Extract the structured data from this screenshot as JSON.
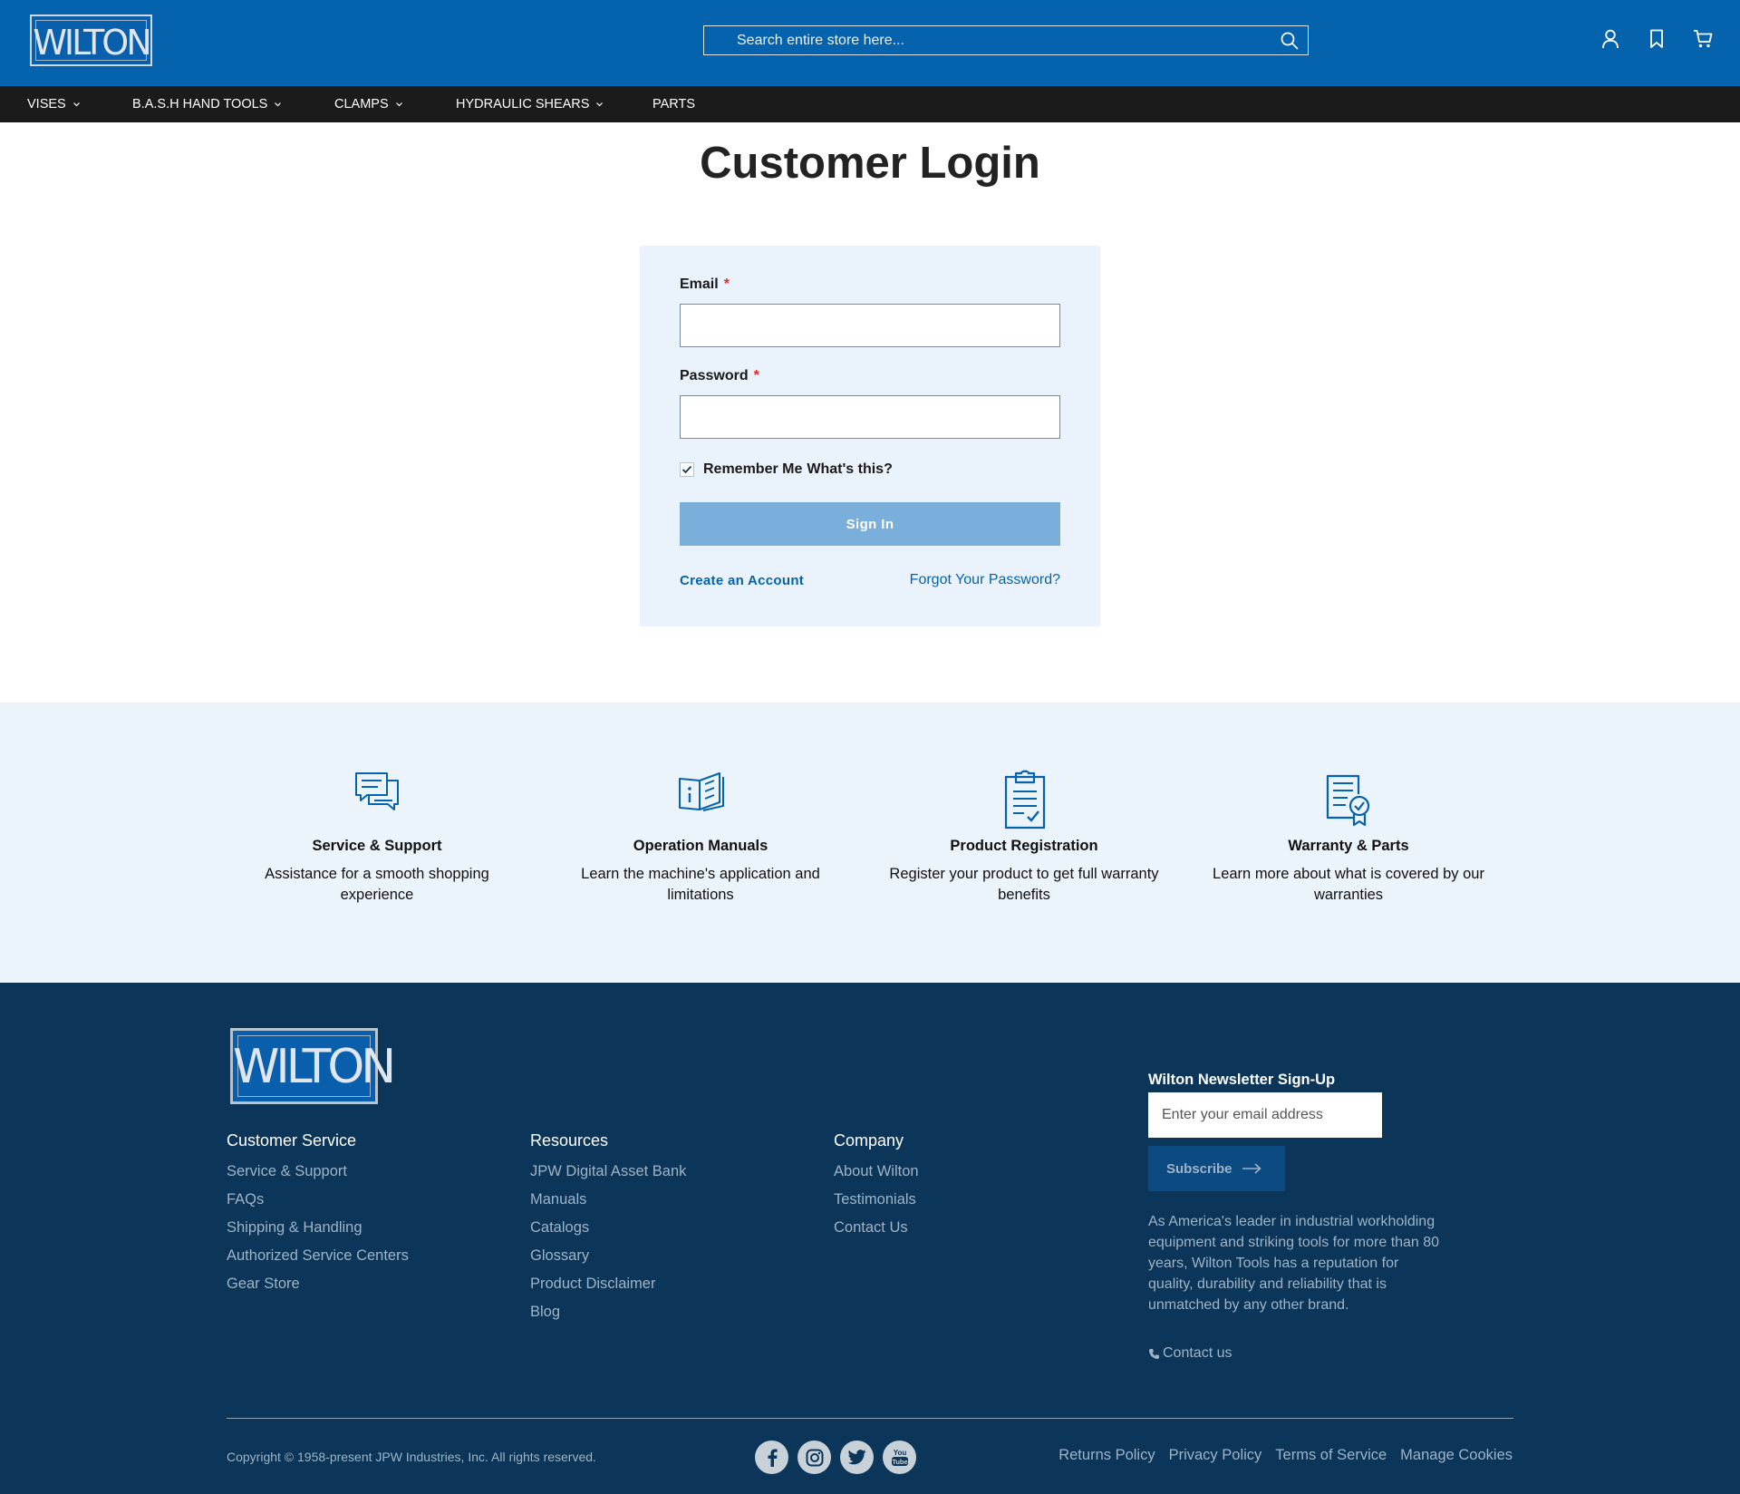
{
  "header": {
    "logo_text": "WILTON",
    "search_placeholder": "Search entire store here...",
    "icons": [
      "account-icon",
      "wishlist-icon",
      "cart-icon"
    ],
    "brand_color": "#0562ac"
  },
  "nav": {
    "items": [
      {
        "label": "VISES",
        "has_dropdown": true
      },
      {
        "label": "B.A.S.H HAND TOOLS",
        "has_dropdown": true
      },
      {
        "label": "CLAMPS",
        "has_dropdown": true
      },
      {
        "label": "HYDRAULIC SHEARS",
        "has_dropdown": true
      },
      {
        "label": "PARTS",
        "has_dropdown": false
      }
    ]
  },
  "login": {
    "title": "Customer Login",
    "email_label": "Email",
    "email_value": "",
    "password_label": "Password",
    "password_value": "",
    "required_mark": "*",
    "remember_label": "Remember Me",
    "remember_checked": true,
    "whats_this": "What's this?",
    "sign_in_label": "Sign In",
    "create_account": "Create an Account",
    "forgot_password": "Forgot Your Password?"
  },
  "features": [
    {
      "icon": "chat-bubbles-icon",
      "title": "Service & Support",
      "text": "Assistance for a smooth shopping experience"
    },
    {
      "icon": "manual-book-icon",
      "title": "Operation Manuals",
      "text": "Learn the machine's application and limitations"
    },
    {
      "icon": "clipboard-check-icon",
      "title": "Product Registration",
      "text": "Register your product to get full warranty benefits"
    },
    {
      "icon": "certificate-icon",
      "title": "Warranty & Parts",
      "text": "Learn more about what is covered by our warranties"
    }
  ],
  "footer": {
    "logo_text": "WILTON",
    "columns": [
      {
        "title": "Customer Service",
        "links": [
          "Service & Support",
          "FAQs",
          "Shipping & Handling",
          "Authorized Service Centers",
          "Gear Store"
        ]
      },
      {
        "title": "Resources",
        "links": [
          "JPW Digital Asset Bank",
          "Manuals",
          "Catalogs",
          "Glossary",
          "Product Disclaimer",
          "Blog"
        ]
      },
      {
        "title": "Company",
        "links": [
          "About Wilton",
          "Testimonials",
          "Contact Us"
        ]
      }
    ],
    "newsletter": {
      "title": "Wilton Newsletter Sign-Up",
      "placeholder": "Enter your email address",
      "button": "Subscribe"
    },
    "about_text": "As America's leader in industrial workholding equipment and striking tools for more than 80 years, Wilton Tools has a reputation for quality, durability and reliability that is unmatched by any other brand.",
    "contact_label": "Contact us",
    "copyright": "Copyright © 1958-present JPW Industries, Inc. All rights reserved.",
    "social": [
      "facebook-icon",
      "instagram-icon",
      "twitter-icon",
      "youtube-icon"
    ],
    "legal_links": [
      "Returns Policy",
      "Privacy Policy",
      "Terms of Service",
      "Manage Cookies"
    ],
    "bg_color": "#0c3659"
  }
}
